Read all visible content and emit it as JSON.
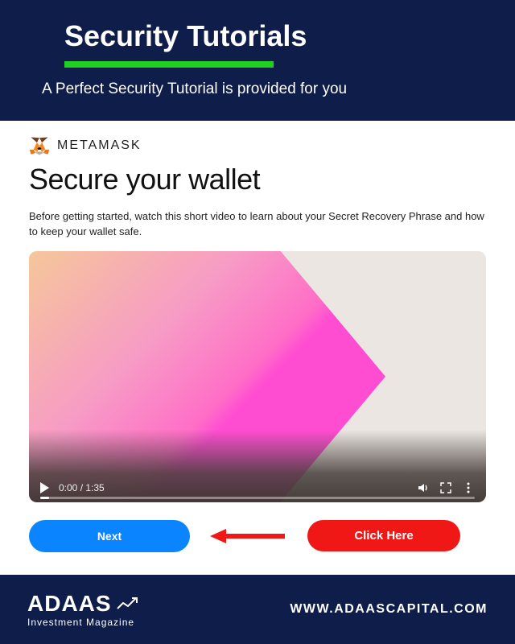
{
  "header": {
    "title": "Security Tutorials",
    "subtitle": "A Perfect Security Tutorial is provided for you",
    "underline_color": "#1fd11f",
    "bg_color": "#0f1d4a"
  },
  "brand": {
    "name": "METAMASK",
    "icon": "fox-icon"
  },
  "main": {
    "heading": "Secure your wallet",
    "description": "Before getting started, watch this short video to learn about your Secret Recovery Phrase and how to keep your wallet safe."
  },
  "video": {
    "current_time": "0:00",
    "duration": "1:35",
    "time_display": "0:00 / 1:35",
    "state": "paused"
  },
  "actions": {
    "next_label": "Next",
    "click_here_label": "Click Here",
    "next_color": "#0a84ff",
    "badge_color": "#f01717"
  },
  "footer": {
    "brand": "ADAAS",
    "tagline": "Investment Magazine",
    "url": "WWW.ADAASCAPITAL.COM",
    "bg_color": "#0f1d4a"
  }
}
